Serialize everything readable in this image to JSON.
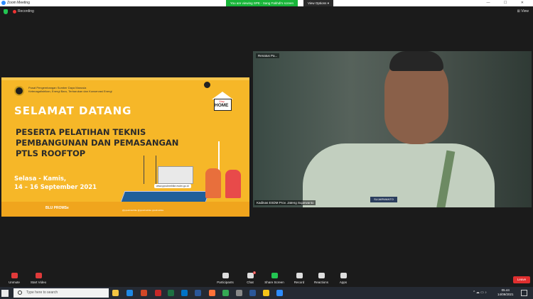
{
  "window": {
    "title": "Zoom Meeting",
    "banner": "You are viewing SPE - Sang Fakhdi's screen",
    "view_options": "View Options",
    "controls": "— ☐ ✕"
  },
  "meeting": {
    "recording_label": "Recording",
    "view_button": "View"
  },
  "slide": {
    "org_line1": "Pusat Pengembangan Sumber Daya Manusia",
    "org_line2": "Ketenagalistrikan, Energi Baru, Terbarukan dan Konservasi Energi",
    "selamat": "SELAMAT DATANG",
    "peserta_line1": "PESERTA PELATIHAN TEKNIS",
    "peserta_line2": "PEMBANGUNAN DAN PEMASANGAN",
    "peserta_line3": "PTLS ROOFTOP",
    "date_line1": "Selasa - Kamis,",
    "date_line2": "14 – 16 September 2021",
    "stay_top": "Stay",
    "stay_home": "HOME",
    "url": "www.ppsdmebtke.esdm.go.id",
    "blu": "BLU PROMSe",
    "socials": "@ppsdmkebtke   @ppsdmebtke   ppsdmebtke"
  },
  "video": {
    "top_label": "Renatus Pa...",
    "bottom_label": "Kadinas ESDM Prov. Jateng Sujarwanto",
    "name_tag": "SUJARWANTO"
  },
  "toolbar": {
    "unmute": "Unmute",
    "start_video": "Start Video",
    "participants": "Participants",
    "participants_count": "40",
    "chat": "Chat",
    "chat_badge": "3",
    "share": "Share Screen",
    "record": "Record",
    "reactions": "Reactions",
    "apps": "Apps",
    "leave": "Leave"
  },
  "taskbar": {
    "search_placeholder": "Type here to search",
    "time": "05.44",
    "date": "14/09/2021",
    "tray": "^ ☁ ▭ ♪"
  },
  "colors": {
    "zoom_blue": "#2d8cff",
    "banner_green": "#18b539",
    "slide_yellow": "#f6b728",
    "leave_red": "#e02f2f"
  }
}
